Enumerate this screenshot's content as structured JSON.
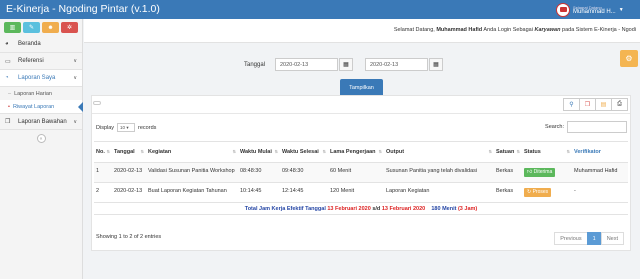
{
  "app": {
    "title": "E-Kinerja - Ngoding Pintar (v.1.0)"
  },
  "user": {
    "greeting": "Selamat Datang,",
    "name": "Muhammad H..."
  },
  "sidebar": {
    "quick_buttons": [
      {
        "icon": "chart-icon",
        "color": "#5cb85c"
      },
      {
        "icon": "pencil-icon",
        "color": "#5bc0de"
      },
      {
        "icon": "users-icon",
        "color": "#f0ad4e"
      },
      {
        "icon": "cogs-icon",
        "color": "#d9534f"
      }
    ],
    "items": [
      {
        "label": "Beranda",
        "icon": "dashboard-icon"
      },
      {
        "label": "Referensi",
        "icon": "monitor-icon"
      },
      {
        "label": "Laporan Saya",
        "icon": "pie-chart-icon"
      },
      {
        "label": "Laporan Bawahan",
        "icon": "copy-icon"
      }
    ],
    "subitems": [
      "Laporan Harian",
      "Riwayat Laporan"
    ]
  },
  "welcome": {
    "prefix": "Selamat Datang,",
    "name": "Muhammad Hafid",
    "middle": "Anda Login Sebagai",
    "role": "Karyawan",
    "suffix": "pada Sistem E-Kinerja - Ngodi"
  },
  "filter": {
    "label": "Tanggal",
    "date_from": "2020-02-13",
    "date_to": "2020-02-13",
    "button": "Tampilkan"
  },
  "table_controls": {
    "display_prefix": "Display",
    "length_value": "10",
    "display_suffix": "records",
    "search_label": "Search:"
  },
  "table": {
    "columns": [
      "No.",
      "Tanggal",
      "Kegiatan",
      "Waktu Mulai",
      "Waktu Selesai",
      "Lama Pengerjaan",
      "Output",
      "Satuan",
      "Status",
      "Verifikator"
    ],
    "rows": [
      {
        "no": "1",
        "tanggal": "2020-02-13",
        "kegiatan": "Validasi Susunan Panitia Workshop",
        "mulai": "08:48:30",
        "selesai": "09:48:30",
        "lama": "60 Menit",
        "output": "Susunan Panitia yang telah divalidasi",
        "satuan": "Berkas",
        "status": "Diterima",
        "verifikator": "Muhammad Hafid"
      },
      {
        "no": "2",
        "tanggal": "2020-02-13",
        "kegiatan": "Buat Laporan Kegiatan Tahunan",
        "mulai": "10:14:45",
        "selesai": "12:14:45",
        "lama": "120 Menit",
        "output": "Laporan Kegiatan",
        "satuan": "Berkas",
        "status": "Proses",
        "verifikator": "-"
      }
    ],
    "total": {
      "prefix": "Total Jam Kerja Efektif Tanggal",
      "from": "13 Februari 2020",
      "sep": "s/d",
      "to": "13 Februari 2020",
      "value": "180 Menit",
      "hours": "(3 Jam)"
    }
  },
  "footer": {
    "info": "Showing 1 to 2 of 2 entries",
    "prev": "Previous",
    "page": "1",
    "next": "Next"
  }
}
